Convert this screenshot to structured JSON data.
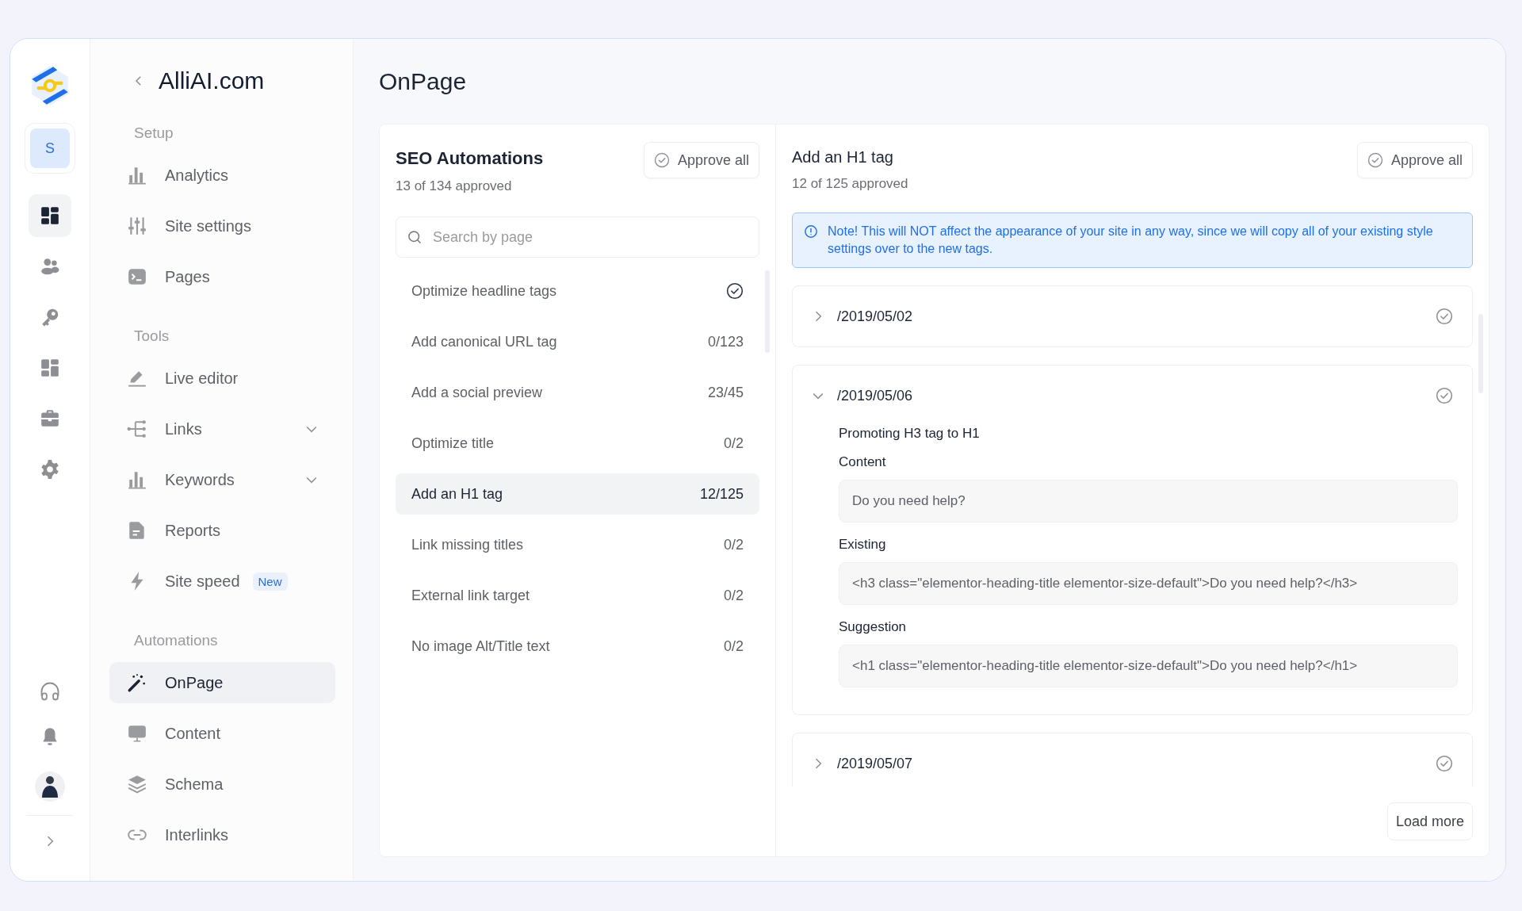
{
  "rail": {
    "workspace": "S",
    "items": [
      {
        "selected": true
      },
      {
        "selected": false
      },
      {
        "selected": false
      },
      {
        "selected": false
      },
      {
        "selected": false
      },
      {
        "selected": false
      }
    ]
  },
  "sidebar": {
    "title": "AlliAI.com",
    "sections": [
      {
        "heading": "Setup",
        "items": [
          {
            "label": "Analytics",
            "selected": false
          },
          {
            "label": "Site settings",
            "selected": false
          },
          {
            "label": "Pages",
            "selected": false
          }
        ]
      },
      {
        "heading": "Tools",
        "items": [
          {
            "label": "Live editor",
            "selected": false
          },
          {
            "label": "Links",
            "selected": false,
            "expanded": false
          },
          {
            "label": "Keywords",
            "selected": false,
            "expanded": false
          },
          {
            "label": "Reports",
            "selected": false
          },
          {
            "label": "Site speed",
            "selected": false,
            "badge": "New"
          }
        ]
      },
      {
        "heading": "Automations",
        "items": [
          {
            "label": "OnPage",
            "selected": true
          },
          {
            "label": "Content",
            "selected": false
          },
          {
            "label": "Schema",
            "selected": false
          },
          {
            "label": "Interlinks",
            "selected": false
          }
        ]
      }
    ]
  },
  "page_title": "OnPage",
  "automations": {
    "title": "SEO Automations",
    "subtitle": "13 of 134 approved",
    "approve_button": "Approve all",
    "search": {
      "placeholder": "Search by page"
    },
    "items": [
      {
        "label": "Optimize headline tags",
        "approved": true,
        "selected": false
      },
      {
        "label": "Add canonical URL tag",
        "count": "0/123",
        "approved": false,
        "selected": false
      },
      {
        "label": "Add a social preview",
        "count": "23/45",
        "approved": false,
        "selected": false
      },
      {
        "label": "Optimize title",
        "count": "0/2",
        "approved": false,
        "selected": false
      },
      {
        "label": "Add an H1 tag",
        "count": "12/125",
        "approved": false,
        "selected": true
      },
      {
        "label": "Link missing titles",
        "count": "0/2",
        "approved": false,
        "selected": false
      },
      {
        "label": "External link target",
        "count": "0/2",
        "approved": false,
        "selected": false
      },
      {
        "label": "No image Alt/Title text",
        "count": "0/2",
        "approved": false,
        "selected": false
      }
    ]
  },
  "detail": {
    "title": "Add an H1 tag",
    "subtitle": "12 of 125 approved",
    "approve_button": "Approve all",
    "note": "Note! This will NOT affect the appearance of your site in any way, since we will copy all of your existing style settings over to the new tags.",
    "pages": [
      {
        "path": "/2019/05/02",
        "expanded": false
      },
      {
        "path": "/2019/05/06",
        "expanded": true,
        "heading": "Promoting H3 tag to H1",
        "fields": [
          {
            "label": "Content",
            "value": "Do you need help?"
          },
          {
            "label": "Existing",
            "value": "<h3 class=\"elementor-heading-title elementor-size-default\">Do you need help?</h3>"
          },
          {
            "label": "Suggestion",
            "value": "<h1 class=\"elementor-heading-title elementor-size-default\">Do you need help?</h1>"
          }
        ]
      },
      {
        "path": "/2019/05/07",
        "expanded": false
      }
    ],
    "load_more": "Load more"
  }
}
